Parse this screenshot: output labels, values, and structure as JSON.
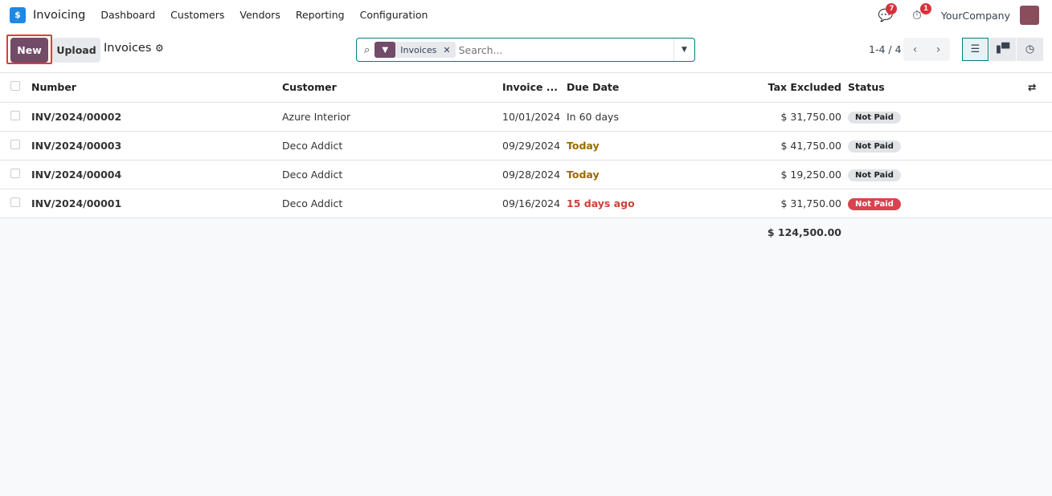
{
  "nav": {
    "logo": "$",
    "app": "Invoicing",
    "menu": [
      "Dashboard",
      "Customers",
      "Vendors",
      "Reporting",
      "Configuration"
    ],
    "messages_count": "7",
    "activities_count": "1",
    "company": "YourCompany"
  },
  "control": {
    "new": "New",
    "upload": "Upload",
    "title": "Invoices",
    "facet": "Invoices",
    "search_placeholder": "Search...",
    "pager": "1-4 / 4"
  },
  "table": {
    "headers": [
      "Number",
      "Customer",
      "Invoice ...",
      "Due Date",
      "Tax Excluded",
      "Status"
    ],
    "rows": [
      {
        "number": "INV/2024/00002",
        "customer": "Azure Interior",
        "date": "10/01/2024",
        "due": "In 60 days",
        "due_style": "normal",
        "amount": "$ 31,750.00",
        "status": "Not Paid",
        "status_style": "grey"
      },
      {
        "number": "INV/2024/00003",
        "customer": "Deco Addict",
        "date": "09/29/2024",
        "due": "Today",
        "due_style": "warning",
        "amount": "$ 41,750.00",
        "status": "Not Paid",
        "status_style": "grey"
      },
      {
        "number": "INV/2024/00004",
        "customer": "Deco Addict",
        "date": "09/28/2024",
        "due": "Today",
        "due_style": "warning",
        "amount": "$ 19,250.00",
        "status": "Not Paid",
        "status_style": "grey"
      },
      {
        "number": "INV/2024/00001",
        "customer": "Deco Addict",
        "date": "09/16/2024",
        "due": "15 days ago",
        "due_style": "danger",
        "amount": "$ 31,750.00",
        "status": "Not Paid",
        "status_style": "red"
      }
    ],
    "total": "$ 124,500.00"
  },
  "colors": {
    "brand": "#714b67",
    "accent": "#017e84",
    "danger": "#d9434e"
  }
}
